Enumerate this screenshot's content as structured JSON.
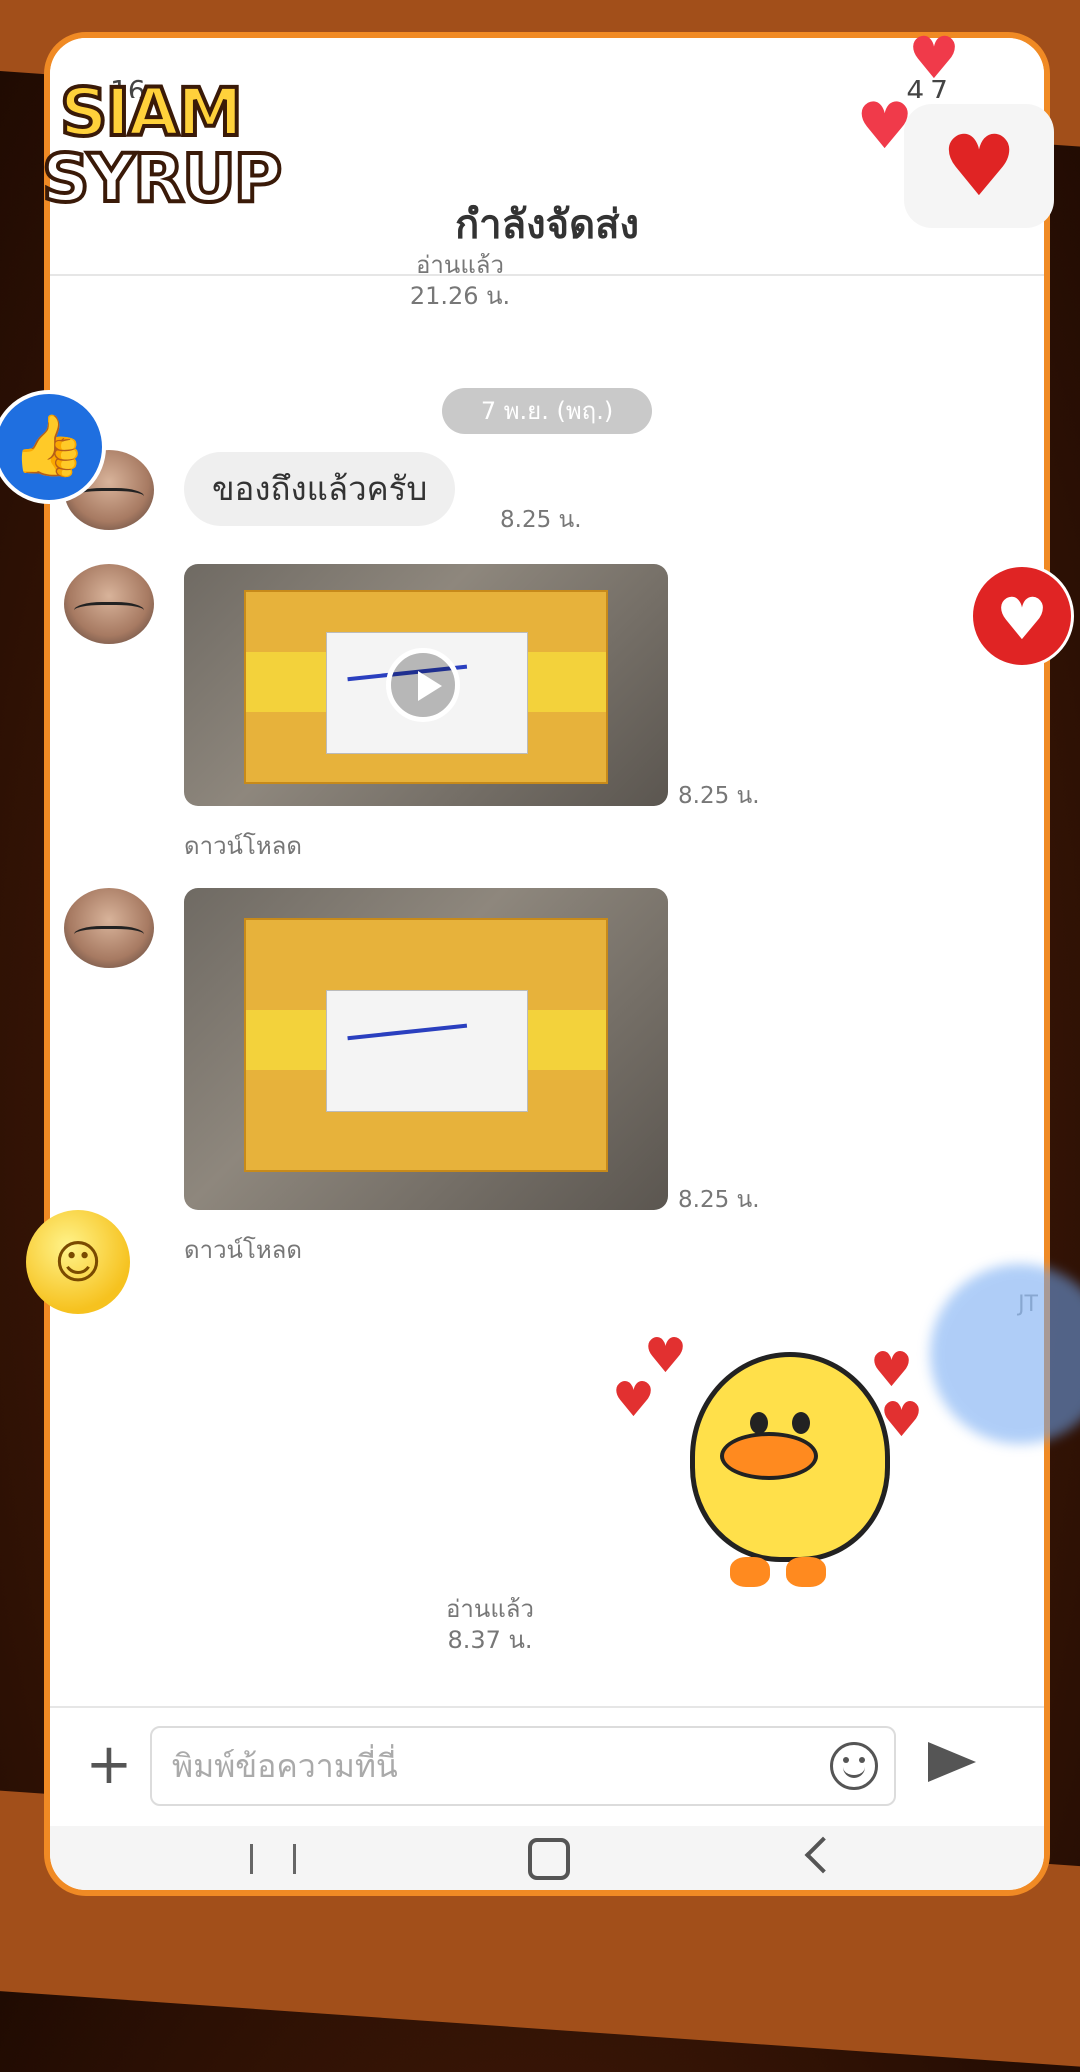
{
  "brand": {
    "logo_line1": "SIAM",
    "logo_line2": "SYRUP"
  },
  "status_bar": {
    "time": "16:",
    "right_text": "47"
  },
  "header": {
    "title": "กำลังจัดส่ง"
  },
  "chat": {
    "top_read_label": "อ่านแล้ว",
    "top_read_time": "21.26 น.",
    "date_separator": "7 พ.ย. (พฤ.)",
    "messages": [
      {
        "type": "text",
        "text": "ของถึงแล้วครับ",
        "time": "8.25 น."
      },
      {
        "type": "video",
        "time": "8.25 น.",
        "download_label": "ดาวน์โหลด"
      },
      {
        "type": "image",
        "time": "8.25 น.",
        "download_label": "ดาวน์โหลด"
      }
    ],
    "sender_initials": "JT",
    "sticker_read_label": "อ่านแล้ว",
    "sticker_read_time": "8.37 น."
  },
  "input": {
    "placeholder": "พิมพ์ข้อความที่นี่"
  },
  "icons": {
    "add": "plus-icon",
    "emoji": "smiley-icon",
    "send": "send-icon",
    "play": "play-icon",
    "nav_recents": "recents-icon",
    "nav_home": "home-icon",
    "nav_back": "back-icon"
  },
  "colors": {
    "frame": "#f08a24",
    "banner": "#a24f1a",
    "like": "#1f6fe0",
    "heart": "#e02424"
  }
}
